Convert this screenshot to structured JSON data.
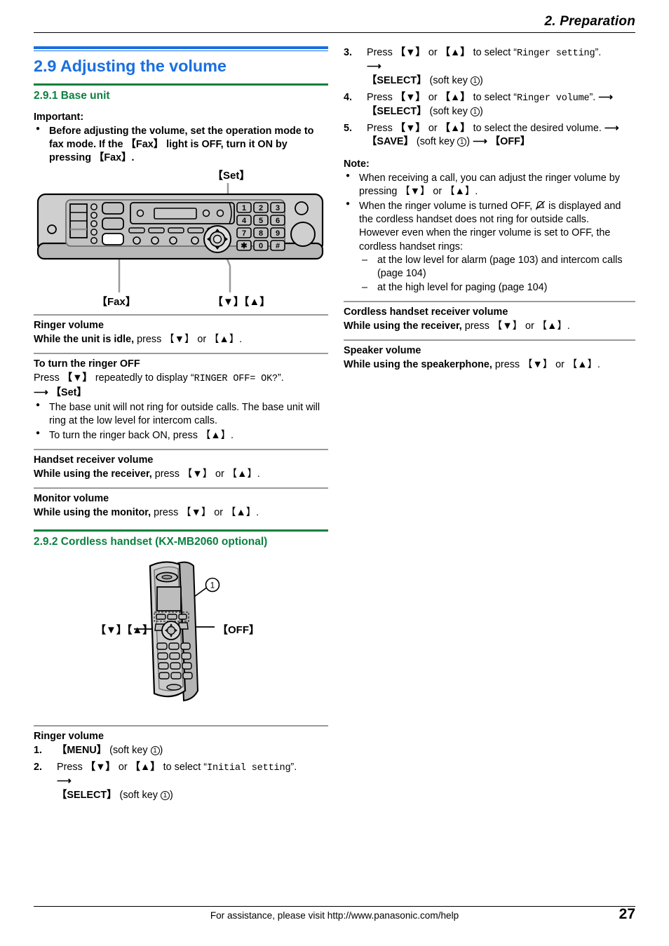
{
  "header": {
    "chapter": "2. Preparation"
  },
  "footer": {
    "assistance": "For assistance, please visit http://www.panasonic.com/help",
    "page_number": "27"
  },
  "colors": {
    "heading_blue": "#1a6fe0",
    "heading_green": "#0a8040",
    "rule_gray": "#9a9a9a"
  },
  "section": {
    "title": "2.9 Adjusting the volume",
    "sub1": "2.9.1 Base unit",
    "sub2": "2.9.2 Cordless handset (KX-MB2060 optional)"
  },
  "important": {
    "label": "Important:",
    "bullet": "Before adjusting the volume, set the operation mode to fax mode. If the 【Fax】 light is OFF, turn it ON by pressing 【Fax】."
  },
  "base_figure": {
    "caption_set": "【Set】",
    "caption_fax": "【Fax】",
    "caption_updown": "【▼】【▲】",
    "keypad": [
      "1",
      "2",
      "3",
      "4",
      "5",
      "6",
      "7",
      "8",
      "9",
      "✱",
      "0",
      "#"
    ]
  },
  "base_sections": [
    {
      "title": "Ringer volume",
      "line_bold": "While the unit is idle,",
      "line_rest": " press 【▼】 or 【▲】."
    },
    {
      "title": "To turn the ringer OFF",
      "press_pre": "Press ",
      "press_key": "【▼】",
      "press_mid": " repeatedly to display “",
      "press_display": "RINGER OFF= OK?",
      "press_post": "”.",
      "arrow_line": "⟶ 【Set】",
      "bullets": [
        "The base unit will not ring for outside calls. The base unit will ring at the low level for intercom calls.",
        "To turn the ringer back ON, press 【▲】."
      ]
    },
    {
      "title": "Handset receiver volume",
      "line_bold": "While using the receiver,",
      "line_rest": " press 【▼】 or 【▲】."
    },
    {
      "title": "Monitor volume",
      "line_bold": "While using the monitor,",
      "line_rest": " press 【▼】 or 【▲】."
    }
  ],
  "handset_figure": {
    "caption_updown": "【▼】【▲】",
    "caption_off": "【OFF】",
    "callout": "1"
  },
  "handset_ringer": {
    "title": "Ringer volume",
    "steps": [
      {
        "parts": [
          {
            "t": "【MENU】",
            "s": "bold"
          },
          {
            "t": " (soft key ",
            "s": "plain"
          },
          {
            "t": "1",
            "s": "circled"
          },
          {
            "t": ")",
            "s": "plain"
          }
        ]
      },
      {
        "parts": [
          {
            "t": "Press ",
            "s": "plain"
          },
          {
            "t": "【▼】",
            "s": "bold"
          },
          {
            "t": " or ",
            "s": "plain"
          },
          {
            "t": "【▲】",
            "s": "bold"
          },
          {
            "t": " to select “",
            "s": "plain"
          },
          {
            "t": "Initial setting",
            "s": "mono"
          },
          {
            "t": "”.",
            "s": "plain"
          },
          {
            "t": "⟶ ",
            "s": "break-bold"
          },
          {
            "t": "【SELECT】",
            "s": "bold"
          },
          {
            "t": " (soft key ",
            "s": "plain"
          },
          {
            "t": "1",
            "s": "circled"
          },
          {
            "t": ")",
            "s": "plain"
          }
        ]
      }
    ]
  },
  "right_steps": [
    {
      "parts": [
        {
          "t": "Press ",
          "s": "plain"
        },
        {
          "t": "【▼】",
          "s": "bold"
        },
        {
          "t": " or ",
          "s": "plain"
        },
        {
          "t": "【▲】",
          "s": "bold"
        },
        {
          "t": " to select “",
          "s": "plain"
        },
        {
          "t": "Ringer setting",
          "s": "mono"
        },
        {
          "t": "”.",
          "s": "plain"
        },
        {
          "t": "⟶ ",
          "s": "break-bold"
        },
        {
          "t": "【SELECT】",
          "s": "bold"
        },
        {
          "t": " (soft key ",
          "s": "plain"
        },
        {
          "t": "1",
          "s": "circled"
        },
        {
          "t": ")",
          "s": "plain"
        }
      ]
    },
    {
      "parts": [
        {
          "t": "Press ",
          "s": "plain"
        },
        {
          "t": "【▼】",
          "s": "bold"
        },
        {
          "t": " or ",
          "s": "plain"
        },
        {
          "t": "【▲】",
          "s": "bold"
        },
        {
          "t": " to select “",
          "s": "plain"
        },
        {
          "t": "Ringer volume",
          "s": "mono"
        },
        {
          "t": "”. ",
          "s": "plain"
        },
        {
          "t": "⟶",
          "s": "bold"
        },
        {
          "t": "【SELECT】",
          "s": "bold-break"
        },
        {
          "t": " (soft key ",
          "s": "plain"
        },
        {
          "t": "1",
          "s": "circled"
        },
        {
          "t": ")",
          "s": "plain"
        }
      ]
    },
    {
      "parts": [
        {
          "t": "Press ",
          "s": "plain"
        },
        {
          "t": "【▼】",
          "s": "bold"
        },
        {
          "t": " or ",
          "s": "plain"
        },
        {
          "t": "【▲】",
          "s": "bold"
        },
        {
          "t": " to select the desired volume. ",
          "s": "plain"
        },
        {
          "t": "⟶",
          "s": "bold"
        },
        {
          "t": "【SAVE】",
          "s": "bold-break"
        },
        {
          "t": " (soft key ",
          "s": "plain"
        },
        {
          "t": "1",
          "s": "circled"
        },
        {
          "t": ") ",
          "s": "plain"
        },
        {
          "t": "⟶ ",
          "s": "bold"
        },
        {
          "t": "【OFF】",
          "s": "bold"
        }
      ]
    }
  ],
  "note": {
    "label": "Note:",
    "bullet1": "When receiving a call, you can adjust the ringer volume by pressing 【▼】 or 【▲】.",
    "bullet2_pre": "When the ringer volume is turned OFF, ",
    "bullet2_icon": "ringer-off-icon",
    "bullet2_post": " is displayed and the cordless handset does not ring for outside calls.",
    "bullet2_cont": "However even when the ringer volume is set to OFF, the cordless handset rings:",
    "dashes": [
      "at the low level for alarm (page 103) and intercom calls (page 104)",
      "at the high level for paging (page 104)"
    ]
  },
  "right_sections": [
    {
      "title": "Cordless handset receiver volume",
      "line_bold": "While using the receiver,",
      "line_rest": " press 【▼】 or 【▲】."
    },
    {
      "title": "Speaker volume",
      "line_bold": "While using the speakerphone,",
      "line_rest": " press 【▼】 or 【▲】."
    }
  ]
}
